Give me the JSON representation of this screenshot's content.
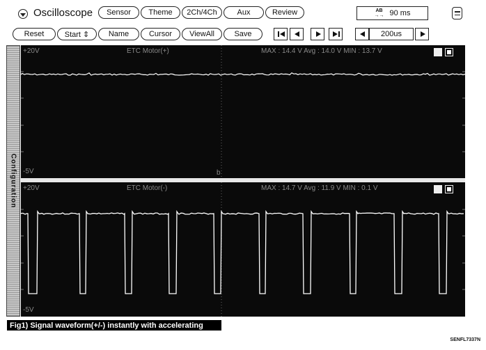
{
  "header": {
    "title": "Oscilloscope",
    "tabs": [
      "Sensor",
      "Theme",
      "2Ch/4Ch",
      "Aux",
      "Review"
    ],
    "time_display": {
      "icon_label_top": "AB",
      "icon_label_bottom": "→→",
      "value": "90 ms"
    }
  },
  "toolbar": {
    "buttons": [
      "Reset",
      "Start ⇕",
      "Name",
      "Cursor",
      "ViewAll",
      "Save"
    ],
    "timebase": "200us"
  },
  "sidebar": {
    "label": "Configuration"
  },
  "channels": [
    {
      "name": "ETC Motor(+)",
      "top_label": "+20V",
      "bottom_label": "-5V",
      "stats": "MAX : 14.4 V   Avg : 14.0 V   MIN : 13.7 V",
      "marker": "b",
      "trace_color": "#ffffff"
    },
    {
      "name": "ETC Motor(-)",
      "top_label": "+20V",
      "bottom_label": "-5V",
      "stats": "MAX : 14.7 V   Avg : 11.9 V   MIN : 0.1 V",
      "trace_color": "#ffffff"
    }
  ],
  "caption": "Fig1) Signal waveform(+/-) instantly with accelerating",
  "figure_code": "SENFL7337N"
}
